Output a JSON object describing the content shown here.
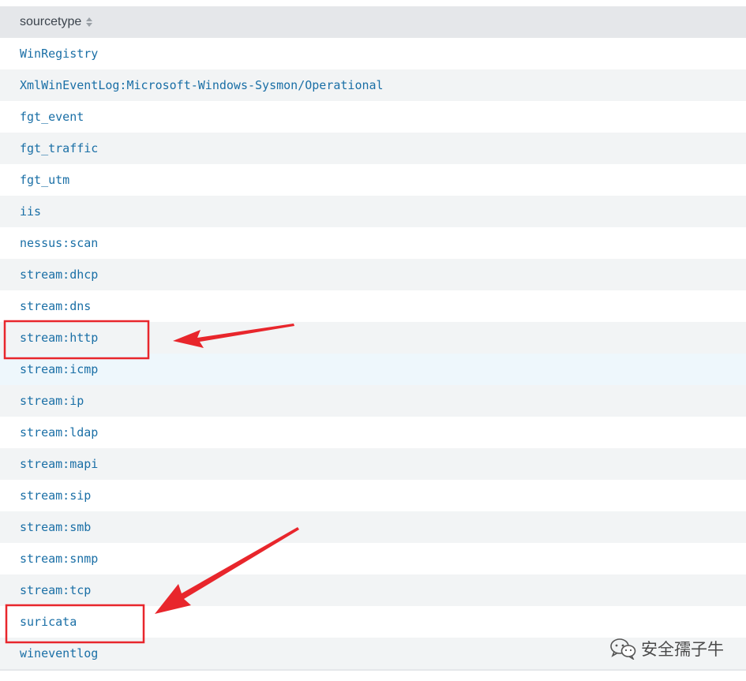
{
  "table": {
    "header": {
      "label": "sourcetype",
      "sort_icon": "sort-icon"
    },
    "rows": [
      "WinRegistry",
      "XmlWinEventLog:Microsoft-Windows-Sysmon/Operational",
      "fgt_event",
      "fgt_traffic",
      "fgt_utm",
      "iis",
      "nessus:scan",
      "stream:dhcp",
      "stream:dns",
      "stream:http",
      "stream:icmp",
      "stream:ip",
      "stream:ldap",
      "stream:mapi",
      "stream:sip",
      "stream:smb",
      "stream:snmp",
      "stream:tcp",
      "suricata",
      "wineventlog"
    ],
    "hovered_row": "stream:icmp"
  },
  "annotations": {
    "color": "#e8262c",
    "highlighted": [
      "stream:http",
      "suricata"
    ]
  },
  "watermark": {
    "icon": "wechat-icon",
    "text": "安全孺子牛"
  }
}
